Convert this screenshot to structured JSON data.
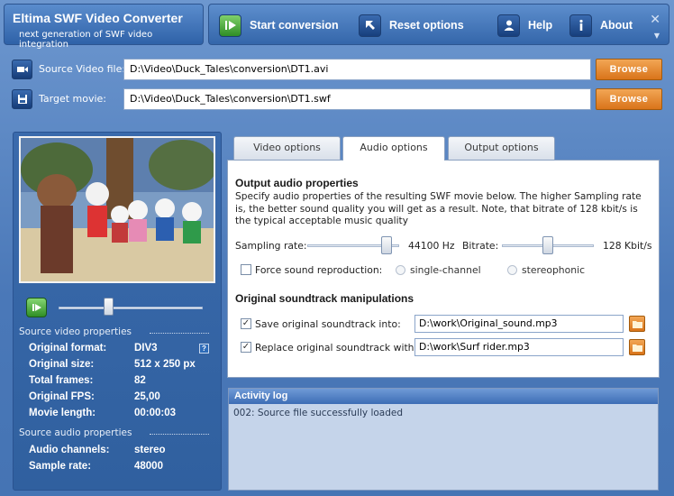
{
  "app": {
    "title": "Eltima SWF Video Converter",
    "subtitle": "next generation of SWF video integration"
  },
  "toolbar": {
    "start": "Start conversion",
    "reset": "Reset options",
    "help": "Help",
    "about": "About",
    "close": "✕",
    "minimize": "▼"
  },
  "source": {
    "label": "Source Video file:",
    "value": "D:\\Video\\Duck_Tales\\conversion\\DT1.avi",
    "browse": "Browse"
  },
  "target": {
    "label": "Target movie:",
    "value": "D:\\Video\\Duck_Tales\\conversion\\DT1.swf",
    "browse": "Browse"
  },
  "player": {
    "seek_fraction": 0.35
  },
  "video_props": {
    "header": "Source video properties",
    "rows": [
      {
        "key": "Original format:",
        "value": "DIV3"
      },
      {
        "key": "Original size:",
        "value": "512 x 250 px"
      },
      {
        "key": "Total frames:",
        "value": "82"
      },
      {
        "key": "Original FPS:",
        "value": "25,00"
      },
      {
        "key": "Movie length:",
        "value": "00:00:03"
      }
    ],
    "help_glyph": "?"
  },
  "audio_props": {
    "header": "Source audio properties",
    "rows": [
      {
        "key": "Audio channels:",
        "value": "stereo"
      },
      {
        "key": "Sample rate:",
        "value": "48000"
      }
    ]
  },
  "tabs": [
    {
      "label": "Video options",
      "active": false
    },
    {
      "label": "Audio options",
      "active": true
    },
    {
      "label": "Output options",
      "active": false
    }
  ],
  "audio_options": {
    "title": "Output audio properties",
    "description": "Specify audio properties of the resulting SWF movie below. The higher Sampling rate is, the better sound quality you will get as a result. Note, that bitrate of 128 kbit/s is the typical acceptable music quality",
    "sampling_label": "Sampling rate:",
    "sampling_value": "44100 Hz",
    "sampling_fraction": 0.86,
    "bitrate_label": "Bitrate:",
    "bitrate_value": "128 Kbit/s",
    "bitrate_fraction": 0.5,
    "force_label": "Force sound reproduction:",
    "force_checked": false,
    "single_label": "single-channel",
    "stereo_label": "stereophonic",
    "manip_title": "Original soundtrack manipulations",
    "save_label": "Save original soundtrack into:",
    "save_checked": true,
    "save_path": "D:\\work\\Original_sound.mp3",
    "replace_label": "Replace original soundtrack with:",
    "replace_checked": true,
    "replace_path": "D:\\work\\Surf rider.mp3"
  },
  "log": {
    "title": "Activity log",
    "lines": [
      "002: Source file successfully loaded"
    ]
  },
  "colors": {
    "accent_orange": "#d9741a",
    "toolbar_blue": "#3466aa",
    "play_green": "#2f8e25"
  }
}
